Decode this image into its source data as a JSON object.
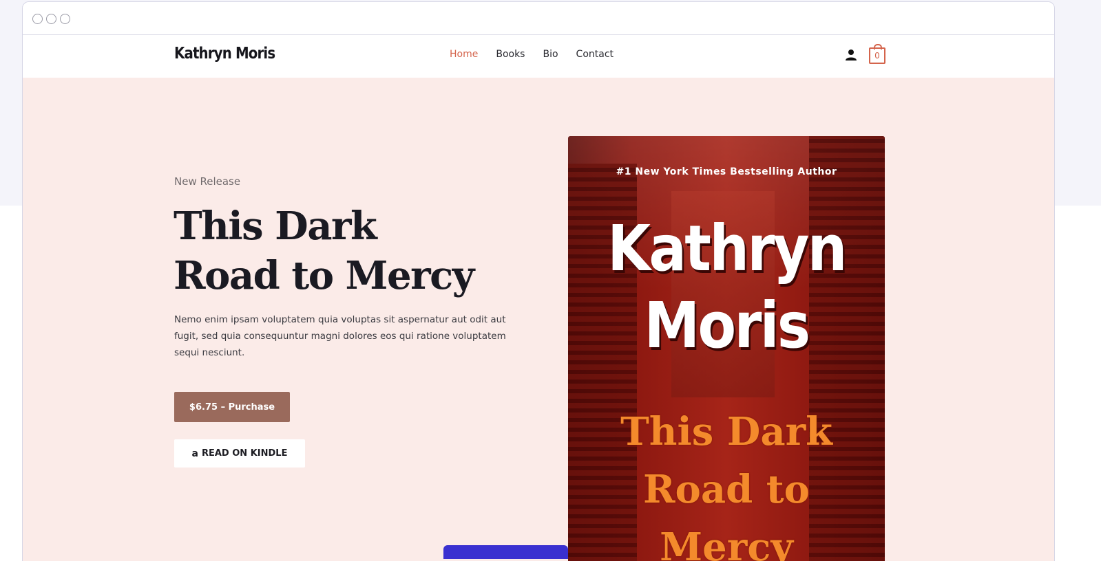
{
  "site": {
    "logo": "Kathryn Moris",
    "nav": [
      {
        "label": "Home",
        "active": true
      },
      {
        "label": "Books",
        "active": false
      },
      {
        "label": "Bio",
        "active": false
      },
      {
        "label": "Contact",
        "active": false
      }
    ],
    "cart_count": "0",
    "accent_color": "#d4644c"
  },
  "hero": {
    "eyebrow": "New Release",
    "title_line1": "This Dark",
    "title_line2": "Road to Mercy",
    "description": "Nemo enim ipsam voluptatem quia voluptas sit aspernatur aut odit aut fugit, sed quia consequuntur magni dolores eos qui ratione voluptatem sequi nesciunt.",
    "purchase_label": "$6.75 – Purchase",
    "kindle_label": "READ ON KINDLE",
    "kindle_icon": "amazon-icon",
    "background_color": "#fbebe8",
    "purchase_color": "#9a6a5c"
  },
  "cover": {
    "tagline": "#1 New York Times Bestselling Author",
    "author_line1": "Kathryn",
    "author_line2": "Moris",
    "title_line1": "This Dark",
    "title_line2": "Road to",
    "title_line3": "Mercy"
  }
}
